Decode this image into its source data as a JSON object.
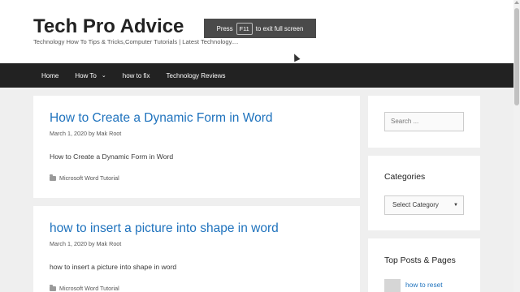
{
  "header": {
    "site_title": "Tech Pro Advice",
    "tagline": "Technology How To Tips & Tricks,Computer Tutorials | Latest Technology...."
  },
  "fullscreen_toast": {
    "prefix": "Press",
    "key": "F11",
    "suffix": "to exit full screen"
  },
  "nav": {
    "items": [
      {
        "label": "Home"
      },
      {
        "label": "How To",
        "has_dropdown": true
      },
      {
        "label": "how to fix"
      },
      {
        "label": "Technology Reviews"
      }
    ]
  },
  "posts": [
    {
      "title": "How to Create a Dynamic Form in Word",
      "date": "March 1, 2020",
      "by": "by",
      "author": "Mak Root",
      "excerpt": "How to Create a Dynamic Form in Word",
      "category": "Microsoft Word Tutorial"
    },
    {
      "title": "how to insert a picture into shape in word",
      "date": "March 1, 2020",
      "by": "by",
      "author": "Mak Root",
      "excerpt": "how to insert a picture into shape in word",
      "category": "Microsoft Word Tutorial"
    }
  ],
  "sidebar": {
    "search_placeholder": "Search ...",
    "categories_title": "Categories",
    "categories_selected": "Select Category",
    "top_posts_title": "Top Posts & Pages",
    "top_posts": [
      {
        "label": "how to reset"
      }
    ]
  },
  "colors": {
    "link": "#1e72bd",
    "nav_bg": "#222222",
    "page_bg": "#efefef"
  }
}
